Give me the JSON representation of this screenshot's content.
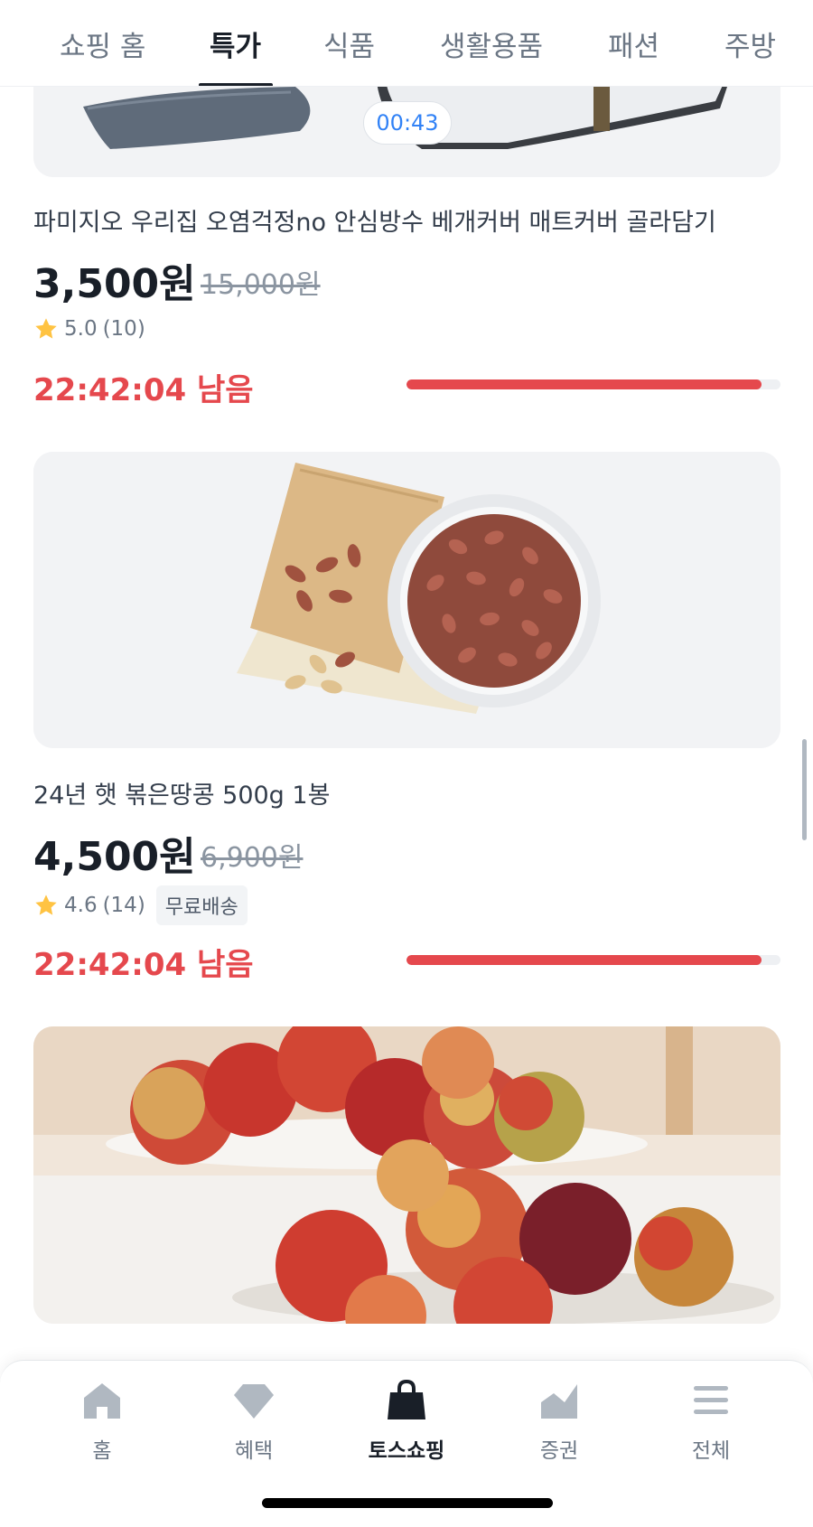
{
  "tabs": [
    {
      "label": "쇼핑 홈",
      "active": false
    },
    {
      "label": "특가",
      "active": true
    },
    {
      "label": "식품",
      "active": false
    },
    {
      "label": "생활용품",
      "active": false
    },
    {
      "label": "패션",
      "active": false
    },
    {
      "label": "주방",
      "active": false
    }
  ],
  "products": [
    {
      "video_time": "00:43",
      "title": "파미지오 우리집 오염걱정no 안심방수 베개커버 매트커버 골라담기",
      "price": "3,500원",
      "original_price": "15,000원",
      "rating": "5.0",
      "review_count": "(10)",
      "timer": "22:42:04 남음",
      "progress": 0.95
    },
    {
      "title": "24년 햇 볶은땅콩 500g 1봉",
      "price": "4,500원",
      "original_price": "6,900원",
      "rating": "4.6",
      "review_count": "(14)",
      "badge": "무료배송",
      "timer": "22:42:04 남음",
      "progress": 0.95
    }
  ],
  "bottom_nav": [
    {
      "label": "홈",
      "icon": "home-icon",
      "active": false
    },
    {
      "label": "혜택",
      "icon": "diamond-icon",
      "active": false
    },
    {
      "label": "토스쇼핑",
      "icon": "shopping-bag-icon",
      "active": true
    },
    {
      "label": "증권",
      "icon": "chart-icon",
      "active": false
    },
    {
      "label": "전체",
      "icon": "menu-icon",
      "active": false
    }
  ],
  "colors": {
    "accent_red": "#e5484d",
    "text_primary": "#191f28",
    "text_secondary": "#6b7684",
    "video_timer_blue": "#3182f6",
    "star_yellow": "#ffc342"
  }
}
